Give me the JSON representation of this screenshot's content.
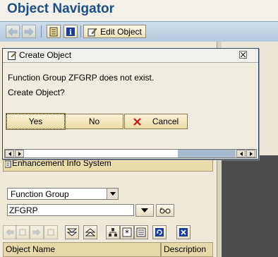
{
  "window": {
    "title": "Object Navigator"
  },
  "toolbar": {
    "back_icon": "arrow-left-icon",
    "forward_icon": "arrow-right-icon",
    "edit_object_label": "Edit Object"
  },
  "dialog": {
    "title": "Create Object",
    "message_line1": "Function Group ZFGRP does not exist.",
    "message_line2": "Create Object?",
    "buttons": {
      "yes": "Yes",
      "no": "No",
      "cancel": "Cancel"
    }
  },
  "navigator": {
    "section_label": "Enhancement Info System",
    "object_type": "Function Group",
    "object_name": "ZFGRP",
    "table_headers": [
      "Object Name",
      "Description"
    ]
  },
  "colors": {
    "title_text": "#1c4f83",
    "toolbar_bg": "#c4d3e5",
    "dialog_border": "#2b4466",
    "cancel_icon": "#cc1414"
  }
}
